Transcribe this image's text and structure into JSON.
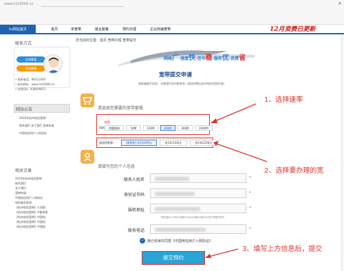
{
  "browser": {
    "address": "www.hz10000.cn",
    "close_glyph": "×"
  },
  "nav": {
    "brand": "hz网站首页",
    "items": [
      "首页",
      "单宽带",
      "融合套餐",
      "预约办理",
      "企业商铺宽带"
    ],
    "banner_tag": "12月资费已更新"
  },
  "sidebar": {
    "contact_title": "联系方式",
    "online_btn_1": "在线客服",
    "online_btn_2": "在线客服",
    "info_lines": [
      "• 联系电话：88311000",
      "• 杭州网址：www.hz10000.cn",
      "• 在线QQ：938009871"
    ],
    "announce_title": "网站公告",
    "announce_lines": [
      "2020年杭州电信宽带！",
      "联系我们  关于我们  宽带申请",
      "中国电信用户入网协议"
    ],
    "related_title": "相关文章",
    "related_lines": [
      "2020年杭州电信宽带！",
      "联系我们",
      "关于我们",
      "宽带申请",
      "中国电信用户入网协议",
      "电信服务条例",
      "【杭州电信宽带】九张图",
      "【杭州电信宽带】#看电视",
      "【杭州电信宽带】中国电",
      "【杭州电信宽带】中国电",
      "【杭州电信宽带】中国电"
    ]
  },
  "main": {
    "breadcrumb": "您当前的位置：首页  宽带办理  宽带提交",
    "slogan": {
      "parts": [
        "网络",
        "广",
        "·速度",
        "快",
        "·信号",
        "稳",
        "·服务",
        "优",
        "·资费",
        "省"
      ]
    },
    "form_title": "宽带提交申请",
    "form_subtitle": "请准确填写信息，方便我们及时联系您（具体资费以杭州电信官网为准）",
    "speed_section": "请选择您需要的宽带套餐",
    "speed_label": "请选择速率：",
    "speed_badge": "推荐",
    "speed_options": [
      "特惠宽带",
      "50M",
      "100M",
      "200M",
      "300M",
      "1000M"
    ],
    "speed_selected_index": 3,
    "pkg_label": "请选择套餐：",
    "pkg_options": [
      "[单宽带] 包1年699元",
      "包1年1320元",
      "包1年2220元"
    ],
    "pkg_selected_index": 0,
    "info_section": "请填写您的个人信息",
    "fields": [
      {
        "label": "联系人姓名",
        "required": "•"
      },
      {
        "label": "身份证号码",
        "required": "•"
      },
      {
        "label": "装机地址",
        "required": "•"
      },
      {
        "label": "联系电话",
        "required": "•"
      }
    ],
    "address_hint": "*请尽量以\"XX区XX路XX小区XX幢XX单元XX室\"的格式填写",
    "agree_check": "✓",
    "agree_text": "我已阅读并同意《中国电信用户入网协议》",
    "submit_label": "提交预约"
  },
  "annotations": {
    "step1": "1、选择速率",
    "step2": "2、选择要办理的宽",
    "step3": "3、填写上方信息后，提交"
  },
  "colors": {
    "accent": "#1e63b3",
    "annot_red": "#e0312a",
    "submit": "#2aa3d6"
  }
}
